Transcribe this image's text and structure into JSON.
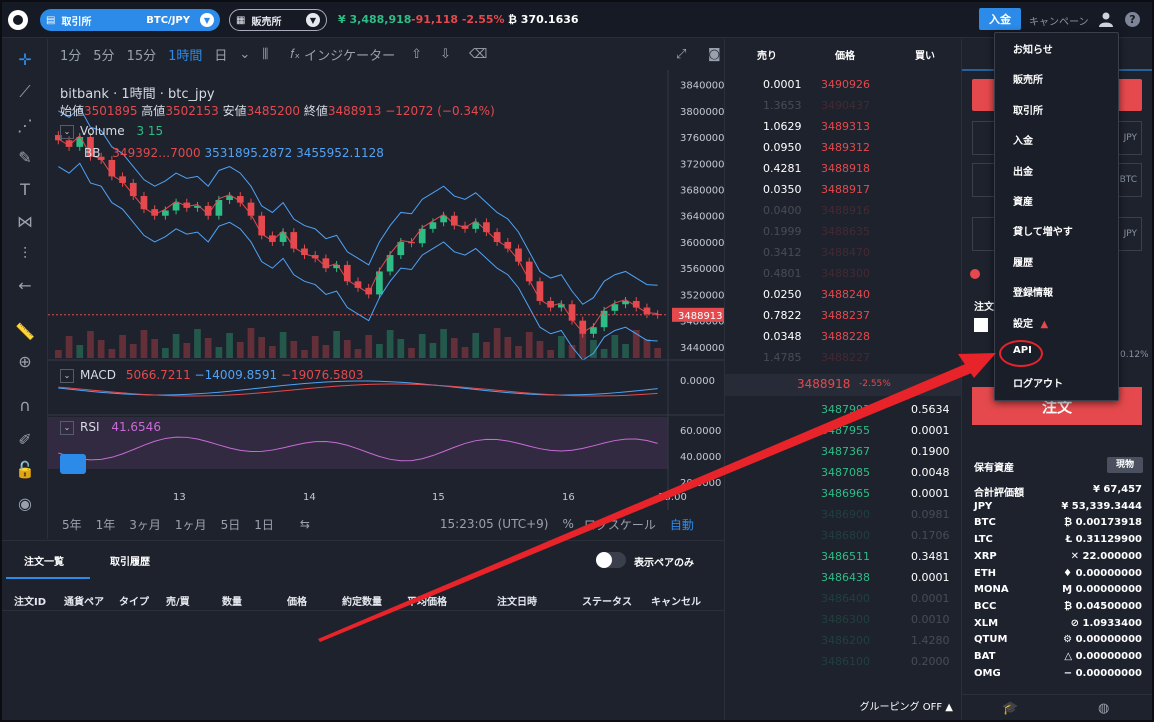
{
  "topbar": {
    "exchange_label": "取引所",
    "pair": "BTC/JPY",
    "shop_label": "販売所",
    "price": "¥ 3,488,918",
    "change": "-91,118 -2.55%",
    "balance": "₿ 370.1636",
    "deposit": "入金",
    "campaign": "キャンペーン"
  },
  "chart_toolbar": {
    "intervals": [
      "1分",
      "5分",
      "15分",
      "1時間",
      "日"
    ],
    "active_interval": "1時間",
    "indicators": "インジケーター"
  },
  "chart_legend": {
    "title": "bitbank · 1時間 · btc_jpy",
    "open_label": "始値",
    "open": "3501895",
    "high_label": "高値",
    "high": "3502153",
    "low_label": "安値",
    "low": "3485200",
    "close_label": "終値",
    "close": "3488913",
    "change": "−12072 (−0.34%)",
    "volume_label": "Volume",
    "volume_value": "3 15",
    "bb_label": "BB",
    "bb_values": [
      "349392…7000",
      "3531895.2872",
      "3455952.1128"
    ],
    "macd_label": "MACD",
    "macd_values": [
      "5066.7211",
      "−14009.8591",
      "−19076.5803"
    ],
    "rsi_label": "RSI",
    "rsi_value": "41.6546"
  },
  "chart_data": {
    "type": "line",
    "price_axis_ticks": [
      "3840000",
      "3800000",
      "3760000",
      "3720000",
      "3680000",
      "3640000",
      "3600000",
      "3560000",
      "3520000",
      "3480000",
      "3440000"
    ],
    "current_price_label": "3488913",
    "macd_axis": [
      "0.0000"
    ],
    "rsi_axis": [
      "60.0000",
      "40.0000",
      "20.0000"
    ],
    "x_ticks": [
      "13",
      "14",
      "15",
      "16",
      "18:00"
    ],
    "close": [
      3755000,
      3745000,
      3760000,
      3730000,
      3725000,
      3700000,
      3690000,
      3670000,
      3650000,
      3640000,
      3648000,
      3660000,
      3652000,
      3655000,
      3640000,
      3664000,
      3670000,
      3660000,
      3640000,
      3610000,
      3600000,
      3615000,
      3590000,
      3580000,
      3575000,
      3560000,
      3565000,
      3540000,
      3530000,
      3520000,
      3555000,
      3580000,
      3600000,
      3598000,
      3620000,
      3630000,
      3640000,
      3625000,
      3620000,
      3630000,
      3615000,
      3600000,
      3590000,
      3570000,
      3540000,
      3510000,
      3500000,
      3505000,
      3480000,
      3460000,
      3470000,
      3495000,
      3505000,
      3510000,
      3500000,
      3490000,
      3488913
    ]
  },
  "chart_bottom": {
    "ranges": [
      "5年",
      "1年",
      "3ヶ月",
      "1ヶ月",
      "5日",
      "1日"
    ],
    "time": "15:23:05 (UTC+9)",
    "percent": "%",
    "log": "ログスケール",
    "auto": "自動"
  },
  "orders": {
    "tab_orders": "注文一覧",
    "tab_history": "取引履歴",
    "toggle_label": "表示ペアのみ",
    "columns": [
      "注文ID",
      "通貨ペア",
      "タイプ",
      "売/買",
      "数量",
      "価格",
      "約定数量",
      "平均価格",
      "注文日時",
      "ステータス",
      "キャンセル"
    ]
  },
  "orderbook": {
    "head_sell": "売り",
    "head_price": "価格",
    "head_buy": "買い",
    "asks": [
      {
        "qty": "0.0001",
        "price": "3490926",
        "dim": false
      },
      {
        "qty": "1.3653",
        "price": "3490437",
        "dim": true
      },
      {
        "qty": "1.0629",
        "price": "3489313",
        "dim": false
      },
      {
        "qty": "0.0950",
        "price": "3489312",
        "dim": false
      },
      {
        "qty": "0.4281",
        "price": "3488918",
        "dim": false
      },
      {
        "qty": "0.0350",
        "price": "3488917",
        "dim": false
      },
      {
        "qty": "0.0400",
        "price": "3488916",
        "dim": true
      },
      {
        "qty": "0.1999",
        "price": "3488635",
        "dim": true
      },
      {
        "qty": "0.3412",
        "price": "3488470",
        "dim": true
      },
      {
        "qty": "0.4801",
        "price": "3488300",
        "dim": true
      },
      {
        "qty": "0.0250",
        "price": "3488240",
        "dim": false
      },
      {
        "qty": "0.7822",
        "price": "3488237",
        "dim": false
      },
      {
        "qty": "0.0348",
        "price": "3488228",
        "dim": false
      },
      {
        "qty": "1.4785",
        "price": "3488227",
        "dim": true
      }
    ],
    "mid_price": "3488918",
    "mid_change": "-2.55%",
    "bids": [
      {
        "price": "3487993",
        "qty": "0.5634",
        "dim": false
      },
      {
        "price": "3487955",
        "qty": "0.0001",
        "dim": false
      },
      {
        "price": "3487367",
        "qty": "0.1900",
        "dim": false
      },
      {
        "price": "3487085",
        "qty": "0.0048",
        "dim": false
      },
      {
        "price": "3486965",
        "qty": "0.0001",
        "dim": false
      },
      {
        "price": "3486900",
        "qty": "0.0981",
        "dim": true
      },
      {
        "price": "3486800",
        "qty": "0.1706",
        "dim": true
      },
      {
        "price": "3486511",
        "qty": "0.3481",
        "dim": false
      },
      {
        "price": "3486438",
        "qty": "0.0001",
        "dim": false
      },
      {
        "price": "3486400",
        "qty": "0.0001",
        "dim": true
      },
      {
        "price": "3486300",
        "qty": "0.0010",
        "dim": true
      },
      {
        "price": "3486200",
        "qty": "1.4280",
        "dim": true
      },
      {
        "price": "3486100",
        "qty": "0.2000",
        "dim": true
      }
    ],
    "grouping": "グルーピング OFF ▲"
  },
  "order_form": {
    "price_unit": "JPY",
    "qty_unit": "BTC",
    "expected_unit": "JPY",
    "order_type_label": "注文",
    "fee_text": "0.12%",
    "submit": "注文"
  },
  "holdings": {
    "title": "保有資産",
    "button": "現物",
    "rows": [
      {
        "name": "合計評価額",
        "amount": "¥ 67,457"
      },
      {
        "name": "JPY",
        "amount": "¥ 53,339.3444"
      },
      {
        "name": "BTC",
        "amount": "₿ 0.00173918"
      },
      {
        "name": "LTC",
        "amount": "Ł 0.31129900"
      },
      {
        "name": "XRP",
        "amount": "✕ 22.000000"
      },
      {
        "name": "ETH",
        "amount": "♦ 0.00000000"
      },
      {
        "name": "MONA",
        "amount": "Ɱ 0.00000000"
      },
      {
        "name": "BCC",
        "amount": "₿ 0.04500000"
      },
      {
        "name": "XLM",
        "amount": "⊘ 1.0933400"
      },
      {
        "name": "QTUM",
        "amount": "⚙ 0.00000000"
      },
      {
        "name": "BAT",
        "amount": "△ 0.00000000"
      },
      {
        "name": "OMG",
        "amount": "− 0.00000000"
      }
    ]
  },
  "menu": {
    "items": [
      "お知らせ",
      "販売所",
      "取引所",
      "入金",
      "出金",
      "資産",
      "貸して増やす",
      "履歴",
      "登録情報",
      "設定",
      "API",
      "ログアウト"
    ]
  },
  "colors": {
    "accent": "#2c8be8",
    "up": "#2ebd85",
    "down": "#e5494d",
    "annotation": "#e8232a"
  }
}
